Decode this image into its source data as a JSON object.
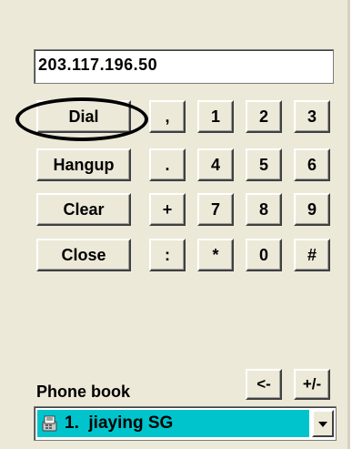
{
  "address": {
    "value": "203.117.196.50"
  },
  "commands": {
    "dial": "Dial",
    "hangup": "Hangup",
    "clear": "Clear",
    "close": "Close"
  },
  "keypad": {
    "row1": [
      ",",
      "1",
      "2",
      "3"
    ],
    "row2": [
      ".",
      "4",
      "5",
      "6"
    ],
    "row3": [
      "+",
      "7",
      "8",
      "9"
    ],
    "row4": [
      ":",
      "*",
      "0",
      "#"
    ]
  },
  "phonebook": {
    "label": "Phone book",
    "backspace": "<-",
    "plusminus": "+/-",
    "selected": "1.  jiaying SG",
    "icon": "phonebook-contact-icon"
  },
  "colors": {
    "panel": "#ece9d8",
    "selection": "#00c4cc"
  }
}
